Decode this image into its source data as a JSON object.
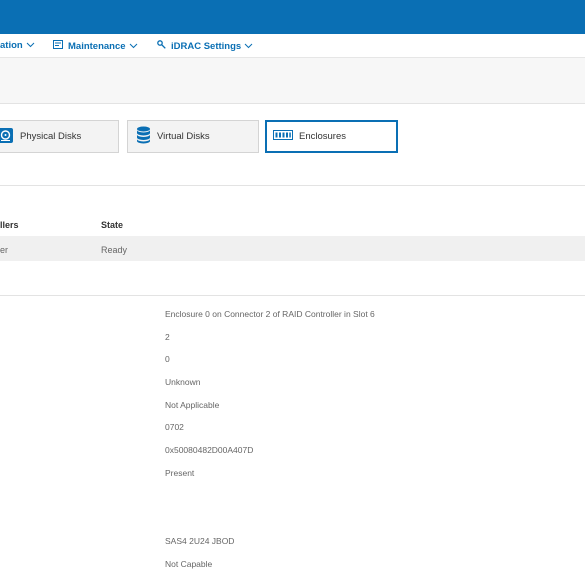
{
  "nav": {
    "items": [
      {
        "label": "ation",
        "has_chevron": true
      },
      {
        "label": "Maintenance",
        "has_chevron": true
      },
      {
        "label": "iDRAC Settings",
        "has_chevron": true
      }
    ]
  },
  "tabs": [
    {
      "label": "Physical Disks",
      "icon": "physical-disk-icon",
      "active": false
    },
    {
      "label": "Virtual Disks",
      "icon": "database-icon",
      "active": false
    },
    {
      "label": "Enclosures",
      "icon": "enclosure-icon",
      "active": true
    }
  ],
  "controllers_table": {
    "headers": [
      "llers",
      "State"
    ],
    "rows": [
      {
        "name": "er",
        "state": "Ready"
      }
    ]
  },
  "details": {
    "values": [
      "Enclosure 0 on Connector 2 of RAID Controller in Slot 6",
      "2",
      "0",
      "Unknown",
      "Not Applicable",
      "0702",
      "0x50080482D00A407D",
      "Present",
      "SAS4 2U24 JBOD",
      "Not Capable"
    ]
  },
  "colors": {
    "brand": "#0a6fb4",
    "row_highlight": "#f0f0f0"
  }
}
